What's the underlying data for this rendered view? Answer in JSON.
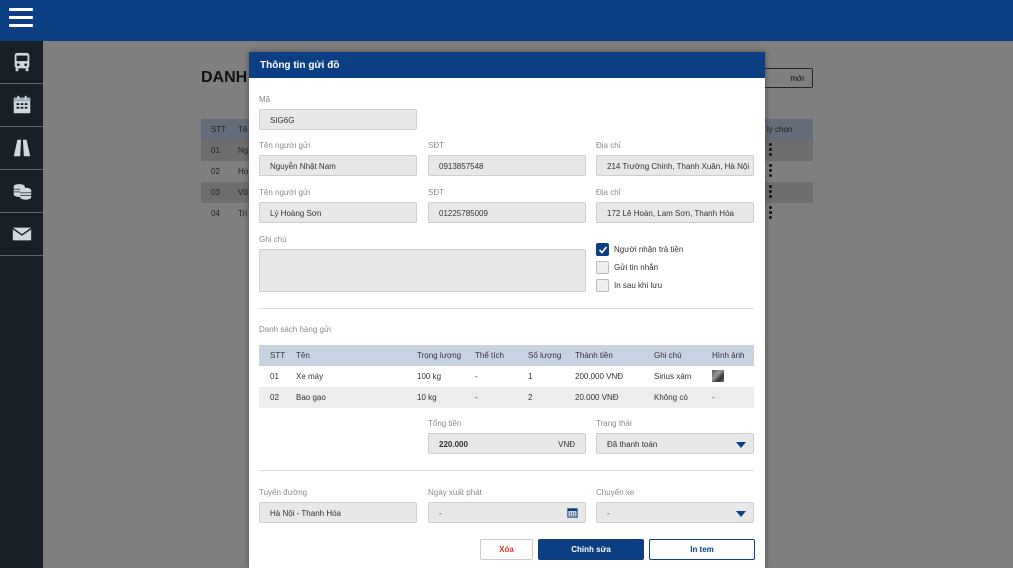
{
  "sidebar": {
    "items": [
      {
        "icon": "bus-icon"
      },
      {
        "icon": "calendar-icon"
      },
      {
        "icon": "road-icon"
      },
      {
        "icon": "coins-icon"
      },
      {
        "icon": "mail-icon"
      }
    ]
  },
  "background": {
    "title": "DANH",
    "add_button": "mới",
    "table_head": {
      "stt": "STT",
      "name": "Tê",
      "action": "ly chọn"
    },
    "rows": [
      {
        "stt": "01",
        "name": "Ng"
      },
      {
        "stt": "02",
        "name": "Ho"
      },
      {
        "stt": "03",
        "name": "Vũ"
      },
      {
        "stt": "04",
        "name": "Trị"
      }
    ]
  },
  "modal": {
    "title": "Thông tin gửi đồ",
    "code_label": "Mã",
    "code_value": "SIG6G",
    "sender_name_label": "Tên người gửi",
    "sender_name": "Nguyễn Nhật Nam",
    "sender_phone_label": "SĐT",
    "sender_phone": "0913857548",
    "sender_address_label": "Địa chỉ",
    "sender_address": "214 Trường Chinh, Thanh Xuân, Hà Nội",
    "receiver_name_label": "Tên người gửi",
    "receiver_name": "Lý Hoàng Sơn",
    "receiver_phone_label": "SĐT",
    "receiver_phone": "01225785009",
    "receiver_address_label": "Địa chỉ",
    "receiver_address": "172 Lê Hoàn, Lam Sơn, Thanh Hóa",
    "note_label": "Ghi chú",
    "checkboxes": [
      {
        "label": "Người nhận trả tiền",
        "checked": true
      },
      {
        "label": "Gửi tin nhắn",
        "checked": false
      },
      {
        "label": "In sau khi lưu",
        "checked": false
      }
    ],
    "goods_label": "Danh sách hàng gửi",
    "goods_head": {
      "stt": "STT",
      "name": "Tên",
      "weight": "Trọng lượng",
      "volume": "Thể tích",
      "qty": "Số lượng",
      "amount": "Thành tiền",
      "note": "Ghi chú",
      "image": "Hình ảnh"
    },
    "goods": [
      {
        "stt": "01",
        "name": "Xe máy",
        "weight": "100 kg",
        "volume": "-",
        "qty": "1",
        "amount": "200.000 VNĐ",
        "note": "Sirius xám",
        "image": ""
      },
      {
        "stt": "02",
        "name": "Bao gạo",
        "weight": "10 kg",
        "volume": "-",
        "qty": "2",
        "amount": "20.000 VNĐ",
        "note": "Không có",
        "image": "-"
      }
    ],
    "total_label": "Tổng tiền",
    "total_value": "220.000",
    "total_unit": "VNĐ",
    "status_label": "Trạng thái",
    "status_value": "Đã thanh toán",
    "route_label": "Tuyến đường",
    "route_value": "Hà Nội - Thanh Hóa",
    "depart_label": "Ngày xuất phát",
    "depart_value": "-",
    "trip_label": "Chuyến xe",
    "trip_value": "-",
    "delete_button": "Xóa",
    "edit_button": "Chỉnh sửa",
    "print_button": "In tem"
  },
  "colors": {
    "primary": "#0b3e83",
    "sidebar": "#172026",
    "danger": "#e0342b",
    "table_head": "#c8d3e2"
  }
}
